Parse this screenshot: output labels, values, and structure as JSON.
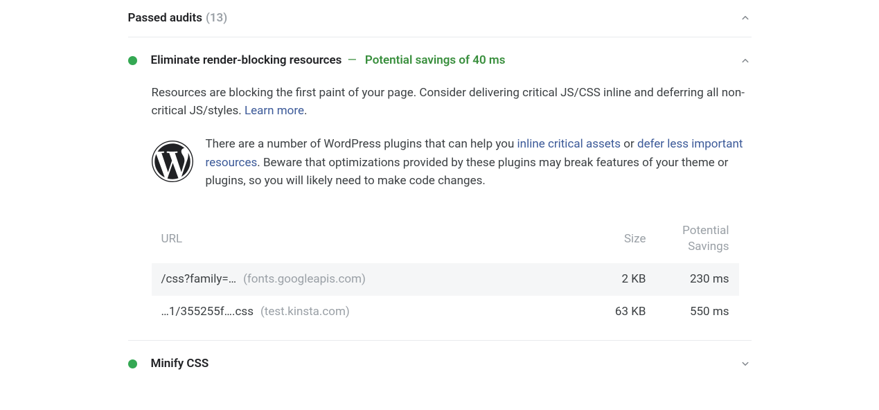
{
  "section": {
    "title": "Passed audits",
    "count": "(13)"
  },
  "audit": {
    "title": "Eliminate render-blocking resources",
    "savings": "Potential savings of 40 ms",
    "desc_before_link": "Resources are blocking the first paint of your page. Consider delivering critical JS/CSS inline and deferring all non-critical JS/styles. ",
    "learn_more": "Learn more",
    "dot": ".",
    "wp_text_a": "There are a number of WordPress plugins that can help you ",
    "wp_link1": "inline critical assets",
    "wp_text_b": " or ",
    "wp_link2": "defer less important resources",
    "wp_text_c": ". Beware that optimizations provided by these plugins may break features of your theme or plugins, so you will likely need to make code changes.",
    "table": {
      "headers": {
        "url": "URL",
        "size": "Size",
        "savings": "Potential Savings"
      },
      "rows": [
        {
          "path": "/css?family=…",
          "origin": "(fonts.googleapis.com)",
          "size": "2 KB",
          "savings": "230 ms"
        },
        {
          "path": "…1/355255f….css",
          "origin": "(test.kinsta.com)",
          "size": "63 KB",
          "savings": "550 ms"
        }
      ]
    }
  },
  "minify": {
    "title": "Minify CSS"
  }
}
